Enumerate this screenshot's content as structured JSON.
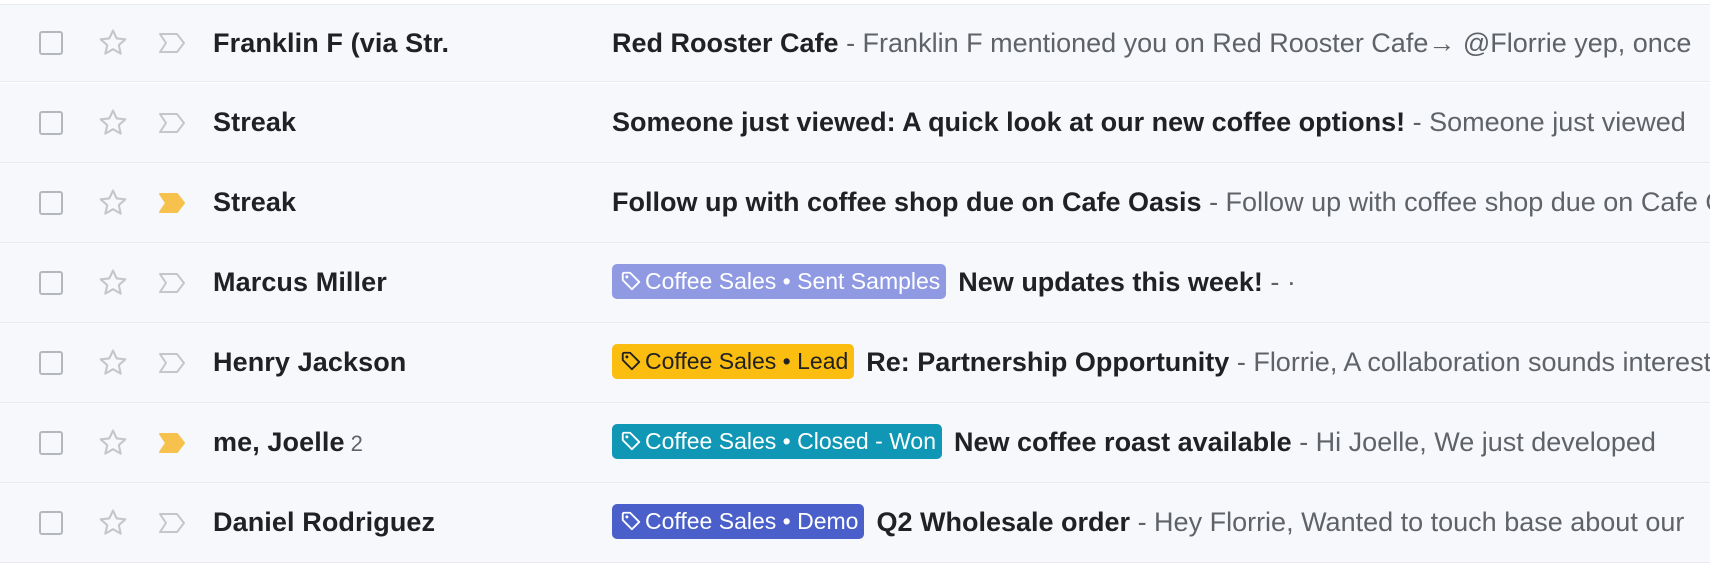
{
  "colors": {
    "row_bg": "#f6f8fc",
    "importance_marked": "#f6c24d",
    "label_sent_samples_bg": "#8f9ae3",
    "label_lead_bg": "#fbbd0f",
    "label_closed_won_bg": "#0f97b5",
    "label_demo_bg": "#4a5fc9"
  },
  "emails": [
    {
      "sender": "Franklin F (via Str.",
      "count": "",
      "label": "",
      "subject": "Red Rooster Cafe",
      "snippet": "- Franklin F mentioned you on Red Rooster Cafe→ @Florrie yep, once",
      "important": false
    },
    {
      "sender": "Streak",
      "count": "",
      "label": "",
      "subject": "Someone just viewed: A quick look at our new coffee options!",
      "snippet": "- Someone just viewed",
      "important": false
    },
    {
      "sender": "Streak",
      "count": "",
      "label": "",
      "subject": "Follow up with coffee shop due on Cafe Oasis",
      "snippet": "- Follow up with coffee shop due on Cafe Oasis",
      "important": true
    },
    {
      "sender": "Marcus Miller",
      "count": "",
      "label": "Coffee Sales • Sent Samples",
      "subject": "New updates this week!",
      "snippet": "- ·",
      "important": false
    },
    {
      "sender": "Henry Jackson",
      "count": "",
      "label": "Coffee Sales • Lead",
      "subject": "Re: Partnership Opportunity",
      "snippet": "- Florrie, A collaboration sounds interesting",
      "important": false
    },
    {
      "sender": "me, Joelle",
      "count": "2",
      "label": "Coffee Sales • Closed - Won",
      "subject": "New coffee roast available",
      "snippet": "- Hi Joelle, We just developed",
      "important": true
    },
    {
      "sender": "Daniel Rodriguez",
      "count": "",
      "label": "Coffee Sales • Demo",
      "subject": "Q2 Wholesale order",
      "snippet": "- Hey Florrie, Wanted to touch base about our",
      "important": false
    }
  ]
}
